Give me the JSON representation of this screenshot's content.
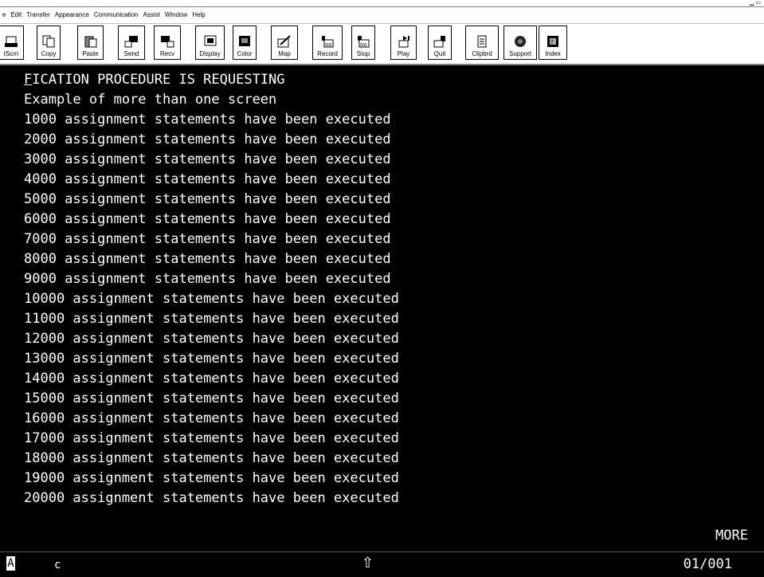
{
  "menu": [
    "e",
    "Edit",
    "Transfer",
    "Appearance",
    "Communication",
    "Assist",
    "Window",
    "Help"
  ],
  "toolbar": [
    {
      "label": "tScrn",
      "icon": "print-screen-icon"
    },
    {
      "label": "Copy",
      "icon": "copy-icon"
    },
    {
      "label": "Paste",
      "icon": "paste-icon"
    },
    {
      "label": "Send",
      "icon": "send-icon"
    },
    {
      "label": "Recv",
      "icon": "receive-icon"
    },
    {
      "label": "Display",
      "icon": "display-icon"
    },
    {
      "label": "Color",
      "icon": "color-icon"
    },
    {
      "label": "Map",
      "icon": "map-icon"
    },
    {
      "label": "Record",
      "icon": "record-icon"
    },
    {
      "label": "Stop",
      "icon": "stop-icon"
    },
    {
      "label": "Play",
      "icon": "play-icon"
    },
    {
      "label": "Quit",
      "icon": "quit-icon"
    },
    {
      "label": "Clipbrd",
      "icon": "clipboard-icon"
    },
    {
      "label": "Support",
      "icon": "support-icon"
    },
    {
      "label": "Index",
      "icon": "index-icon"
    }
  ],
  "terminal": {
    "lines": [
      "FICATION PROCEDURE IS REQUESTING",
      "Example of more than one screen",
      "1000 assignment statements have been executed",
      "2000 assignment statements have been executed",
      "3000 assignment statements have been executed",
      "4000 assignment statements have been executed",
      "5000 assignment statements have been executed",
      "6000 assignment statements have been executed",
      "7000 assignment statements have been executed",
      "8000 assignment statements have been executed",
      "9000 assignment statements have been executed",
      "10000 assignment statements have been executed",
      "11000 assignment statements have been executed",
      "12000 assignment statements have been executed",
      "13000 assignment statements have been executed",
      "14000 assignment statements have been executed",
      "15000 assignment statements have been executed",
      "16000 assignment statements have been executed",
      "17000 assignment statements have been executed",
      "18000 assignment statements have been executed",
      "19000 assignment statements have been executed",
      "20000 assignment statements have been executed"
    ],
    "more": "MORE"
  },
  "status": {
    "mode": "A",
    "field": "c",
    "arrow": "⇧",
    "position": "01/001"
  }
}
